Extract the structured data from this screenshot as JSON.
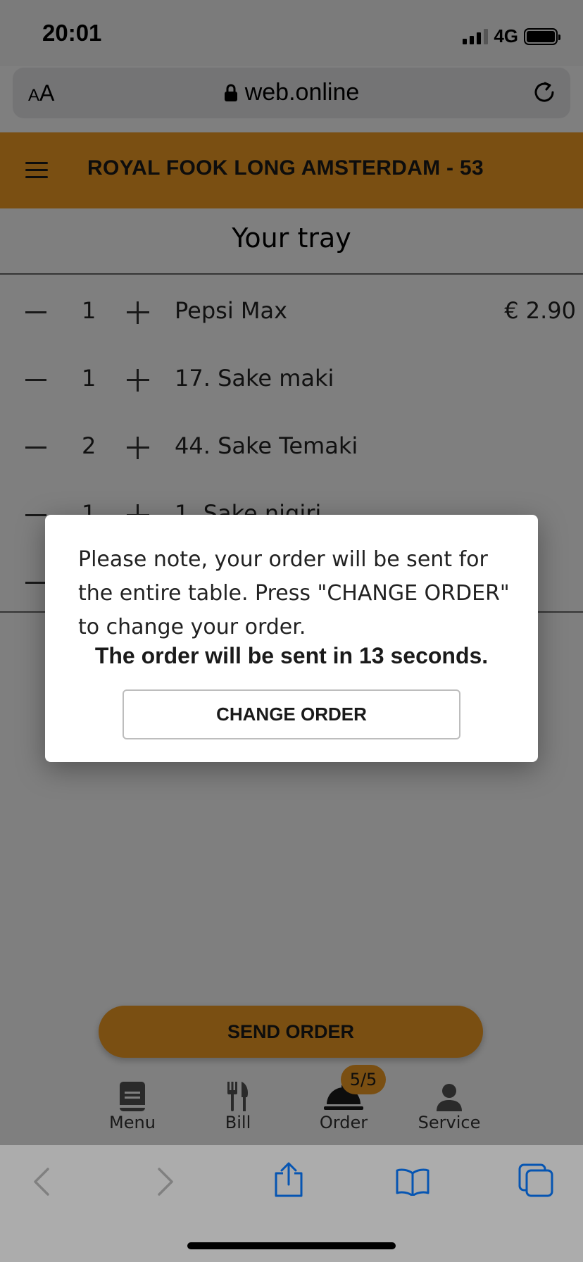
{
  "status_bar": {
    "time": "20:01",
    "network": "4G"
  },
  "browser": {
    "aa_small": "A",
    "aa_big": "A",
    "url": "web.online"
  },
  "app": {
    "title": "ROYAL FOOK LONG AMSTERDAM - 53"
  },
  "tray": {
    "title": "Your tray",
    "items": [
      {
        "qty": "1",
        "name": "Pepsi Max",
        "price": "€ 2.90"
      },
      {
        "qty": "1",
        "name": "17. Sake maki",
        "price": ""
      },
      {
        "qty": "2",
        "name": "44. Sake Temaki",
        "price": ""
      },
      {
        "qty": "1",
        "name": "1. Sake nigiri",
        "price": ""
      }
    ]
  },
  "send_order_label": "SEND ORDER",
  "bottom_nav": {
    "items": [
      {
        "label": "Menu",
        "icon": "book-icon"
      },
      {
        "label": "Bill",
        "icon": "cutlery-icon"
      },
      {
        "label": "Order",
        "icon": "service-bell-icon"
      },
      {
        "label": "Service",
        "icon": "person-icon"
      }
    ],
    "order_badge": "5/5"
  },
  "dialog": {
    "message": "Please note, your order will be sent for the entire table. Press \"CHANGE ORDER\" to change your order.",
    "countdown": "The order will be sent in 13 seconds.",
    "button_label": "CHANGE ORDER"
  },
  "colors": {
    "accent": "#f59e24",
    "safari_blue": "#0a7aff"
  }
}
